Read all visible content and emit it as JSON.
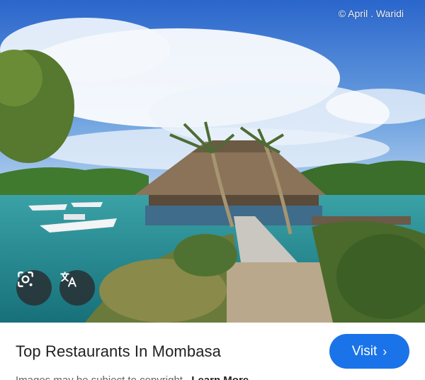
{
  "image": {
    "watermark": "© April . Waridi",
    "description_icon_lens": "lens-icon",
    "description_icon_translate": "translate-icon"
  },
  "result": {
    "title": "Top Restaurants In Mombasa",
    "visit_label": "Visit",
    "visit_chevron": "›",
    "copyright_text": "Images may be subject to copyright.",
    "learn_more": "Learn More"
  },
  "colors": {
    "accent": "#1a73e8",
    "title_text": "#202124",
    "muted_text": "#5f6368",
    "overlay_button": "#282c30"
  }
}
